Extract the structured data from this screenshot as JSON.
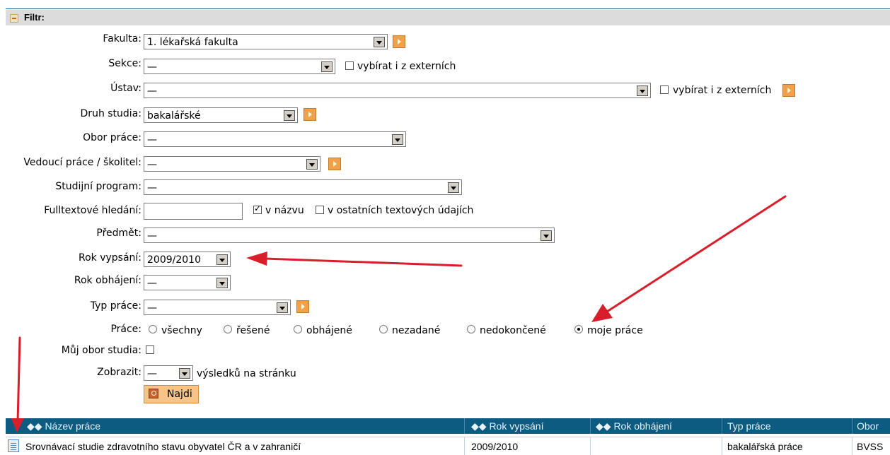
{
  "filter": {
    "title": "Filtr:",
    "fields": {
      "fakulta": {
        "label": "Fakulta:",
        "value": "1. lékařská fakulta"
      },
      "sekce": {
        "label": "Sekce:",
        "value": "—",
        "ext_label": "vybírat i z externích"
      },
      "ustav": {
        "label": "Ústav:",
        "value": "—",
        "ext_label": "vybírat i z externích"
      },
      "druh_studia": {
        "label": "Druh studia:",
        "value": "bakalářské"
      },
      "obor_prace": {
        "label": "Obor práce:",
        "value": "—"
      },
      "vedouci": {
        "label": "Vedoucí práce / školitel:",
        "value": "—"
      },
      "program": {
        "label": "Studijní program:",
        "value": "—"
      },
      "fulltext": {
        "label": "Fulltextové hledání:",
        "value": "",
        "in_title_label": "v názvu",
        "in_title_checked": true,
        "other_label": "v ostatních textových údajích",
        "other_checked": false
      },
      "predmet": {
        "label": "Předmět:",
        "value": "—"
      },
      "rok_vypsani": {
        "label": "Rok vypsání:",
        "value": "2009/2010"
      },
      "rok_obhajeni": {
        "label": "Rok obhájení:",
        "value": "—"
      },
      "typ_prace": {
        "label": "Typ práce:",
        "value": "—"
      },
      "prace": {
        "label": "Práce:",
        "options": [
          "všechny",
          "řešené",
          "obhájené",
          "nezadané",
          "nedokončené",
          "moje práce"
        ],
        "selected": "moje práce"
      },
      "muj_obor": {
        "label": "Můj obor studia:",
        "checked": false
      },
      "zobrazit": {
        "label": "Zobrazit:",
        "value": "—",
        "suffix": "výsledků na stránku"
      }
    },
    "search_button": "Najdi"
  },
  "table": {
    "headers": [
      "Název práce",
      "Rok vypsání",
      "Rok obhájení",
      "Typ práce",
      "Obor"
    ],
    "rows": [
      {
        "title": "Srovnávací studie zdravotního stavu obyvatel ČR a v zahraničí",
        "rok_vypsani": "2009/2010",
        "rok_obhajeni": "",
        "typ": "bakalářská práce",
        "obor": "BVSS"
      }
    ]
  },
  "colors": {
    "header_bg": "#0e5b82",
    "accent_button": "#f6c489",
    "annotation_arrow": "#d81e2a"
  }
}
